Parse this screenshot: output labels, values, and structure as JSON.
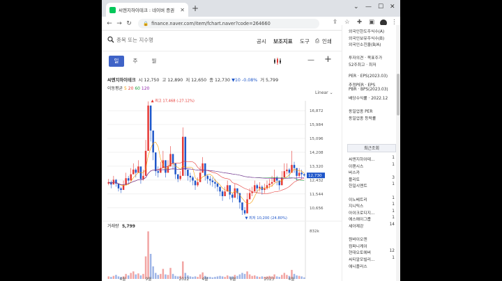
{
  "browser": {
    "tab_title": "씨엔지하이테크 : 네이버 증권",
    "url": "finance.naver.com/item/fchart.naver?code=264660"
  },
  "toolbar": {
    "search_placeholder": "종목 또는 지수명",
    "announce": "공시",
    "indicators": "보조지표",
    "tools": "도구",
    "print": "인쇄"
  },
  "periods": [
    "일",
    "주",
    "월"
  ],
  "active_period": "일",
  "stock": {
    "name": "씨엔지하이테크",
    "open_label": "시",
    "open": "12,750",
    "high_label": "고",
    "high": "12,890",
    "low_label": "저",
    "low": "12,650",
    "close_label": "종",
    "close": "12,730",
    "change": "▼10 -0.08%",
    "volume_label": "거",
    "volume": "5,799"
  },
  "ma": {
    "label": "이동평균",
    "p1": "5",
    "p2": "20",
    "p3": "60",
    "p4": "120"
  },
  "scale_mode": "Linear",
  "chart_data": {
    "type": "candlestick",
    "y_ticks": [
      10656,
      11544,
      12432,
      13320,
      14208,
      15096,
      15984,
      16872
    ],
    "ylim": [
      10200,
      17500
    ],
    "current_price": "12,730",
    "high_annotation": "최고 17,468 (-27.12%)",
    "low_annotation": "최저 10,200 (24.80%)",
    "x_labels": [
      "4월",
      "9월",
      "2022",
      "4월",
      "8월",
      "2023",
      "4월"
    ],
    "volume_label": "거래량",
    "volume_value": "5,799",
    "volume_max": "832k",
    "close_series": [
      12300,
      12150,
      12450,
      12200,
      11900,
      11800,
      12100,
      12550,
      12400,
      12800,
      13100,
      12900,
      13300,
      12500,
      12700,
      14300,
      17200,
      15600,
      14200,
      13000,
      12900,
      13200,
      13700,
      12900,
      13300,
      14100,
      13500,
      12800,
      12500,
      12700,
      15200,
      13100,
      12700,
      12600,
      12400,
      12100,
      12300,
      12900,
      13500,
      12700,
      12500,
      12400,
      12300,
      12200,
      12000,
      11700,
      11400,
      11700,
      12100,
      11500,
      11300,
      11900,
      11600,
      11000,
      10500,
      10300,
      11200,
      11600,
      11700,
      12100,
      11900,
      12000,
      11800,
      11900,
      12100,
      12200,
      12300,
      12600,
      12400,
      12100,
      12600,
      13000,
      13100,
      12900,
      13400,
      13200,
      12700,
      12900,
      12800,
      12730
    ],
    "high_series": [
      12500,
      12400,
      12700,
      12500,
      12100,
      12000,
      12400,
      12900,
      12700,
      13200,
      13500,
      13200,
      13700,
      12900,
      13100,
      15000,
      17468,
      16200,
      14800,
      13400,
      13300,
      13600,
      14300,
      13300,
      13700,
      14600,
      14000,
      13200,
      12800,
      13000,
      15800,
      13600,
      13100,
      12900,
      12700,
      12400,
      12600,
      13300,
      13900,
      13000,
      12800,
      12700,
      12600,
      12500,
      12300,
      12000,
      11800,
      12000,
      12400,
      11800,
      11600,
      12200,
      11900,
      11400,
      10900,
      10700,
      11600,
      11900,
      12000,
      12400,
      12200,
      12300,
      12100,
      12200,
      12400,
      12500,
      12700,
      13100,
      12700,
      12400,
      13000,
      13500,
      13500,
      13200,
      14300,
      13600,
      13100,
      13200,
      13100,
      12890
    ],
    "low_series": [
      12100,
      11900,
      12200,
      12000,
      11700,
      11600,
      11800,
      12200,
      12200,
      12500,
      12800,
      12600,
      12900,
      12200,
      12400,
      13900,
      15500,
      14900,
      13700,
      12700,
      12600,
      12900,
      13300,
      12600,
      13000,
      13700,
      13100,
      12500,
      12300,
      12400,
      12800,
      12700,
      12400,
      12300,
      12100,
      11800,
      12000,
      12600,
      13100,
      12400,
      12200,
      12100,
      12000,
      11900,
      11700,
      11400,
      11100,
      11400,
      11800,
      11200,
      11000,
      11600,
      11200,
      10600,
      10200,
      10200,
      10800,
      11300,
      11400,
      11800,
      11600,
      11700,
      11500,
      11600,
      11800,
      11900,
      12000,
      12300,
      12100,
      11800,
      12300,
      12700,
      12800,
      12600,
      13000,
      12900,
      12400,
      12600,
      12500,
      12650
    ],
    "volume_series": [
      0.05,
      0.04,
      0.06,
      0.08,
      0.05,
      0.04,
      0.05,
      0.1,
      0.07,
      0.12,
      0.15,
      0.09,
      0.11,
      0.07,
      0.1,
      0.45,
      0.95,
      0.5,
      0.25,
      0.12,
      0.08,
      0.1,
      0.2,
      0.09,
      0.08,
      0.22,
      0.1,
      0.06,
      0.05,
      0.06,
      0.35,
      0.12,
      0.07,
      0.05,
      0.04,
      0.05,
      0.04,
      0.09,
      0.13,
      0.06,
      0.04,
      0.04,
      0.03,
      0.04,
      0.05,
      0.06,
      0.05,
      0.04,
      0.07,
      0.05,
      0.05,
      0.08,
      0.06,
      0.09,
      0.12,
      0.1,
      0.15,
      0.09,
      0.06,
      0.07,
      0.05,
      0.04,
      0.05,
      0.04,
      0.05,
      0.06,
      0.05,
      0.09,
      0.05,
      0.04,
      0.08,
      0.12,
      0.08,
      0.06,
      0.18,
      0.1,
      0.07,
      0.06,
      0.05,
      0.03
    ]
  },
  "right_panel": {
    "lines": [
      "외국인한도주식수(A)",
      "외국인보유주식수(B)",
      "외국인소진율(B/A)",
      "",
      "투자의견 · 목표주가",
      "52주최고 · 최저",
      "",
      "PER · EPS(2023.03)",
      "추정PER · EPS",
      "PBR · BPS(2023.03)",
      "배당수익률 · 2022.12",
      "",
      "동일업종 PER",
      "동일업종 등락률"
    ],
    "recent_title": "최근조회",
    "recent": [
      {
        "name": "씨엔지하이테...",
        "count": "1"
      },
      {
        "name": "이랜시스",
        "count": "1"
      },
      {
        "name": "버스카",
        "count": ""
      },
      {
        "name": "플리토",
        "count": "3"
      },
      {
        "name": "한일시멘트",
        "count": "1"
      },
      {
        "name": "",
        "count": ""
      },
      {
        "name": "이노베트리",
        "count": "1"
      },
      {
        "name": "지니틱스",
        "count": "1"
      },
      {
        "name": "아이크로디지...",
        "count": "1"
      },
      {
        "name": "에스에이그룹",
        "count": "1"
      },
      {
        "name": "세아제강",
        "count": "14"
      },
      {
        "name": "",
        "count": ""
      },
      {
        "name": "원바이오젠",
        "count": ""
      },
      {
        "name": "컴퍼니케이",
        "count": ""
      },
      {
        "name": "현대오토에버",
        "count": "12"
      },
      {
        "name": "씨티알모빌리...",
        "count": "1"
      },
      {
        "name": "애니플러스",
        "count": ""
      }
    ]
  },
  "colors": {
    "up": "#e53935",
    "down": "#1e56c9",
    "accent": "#3f63c7"
  }
}
